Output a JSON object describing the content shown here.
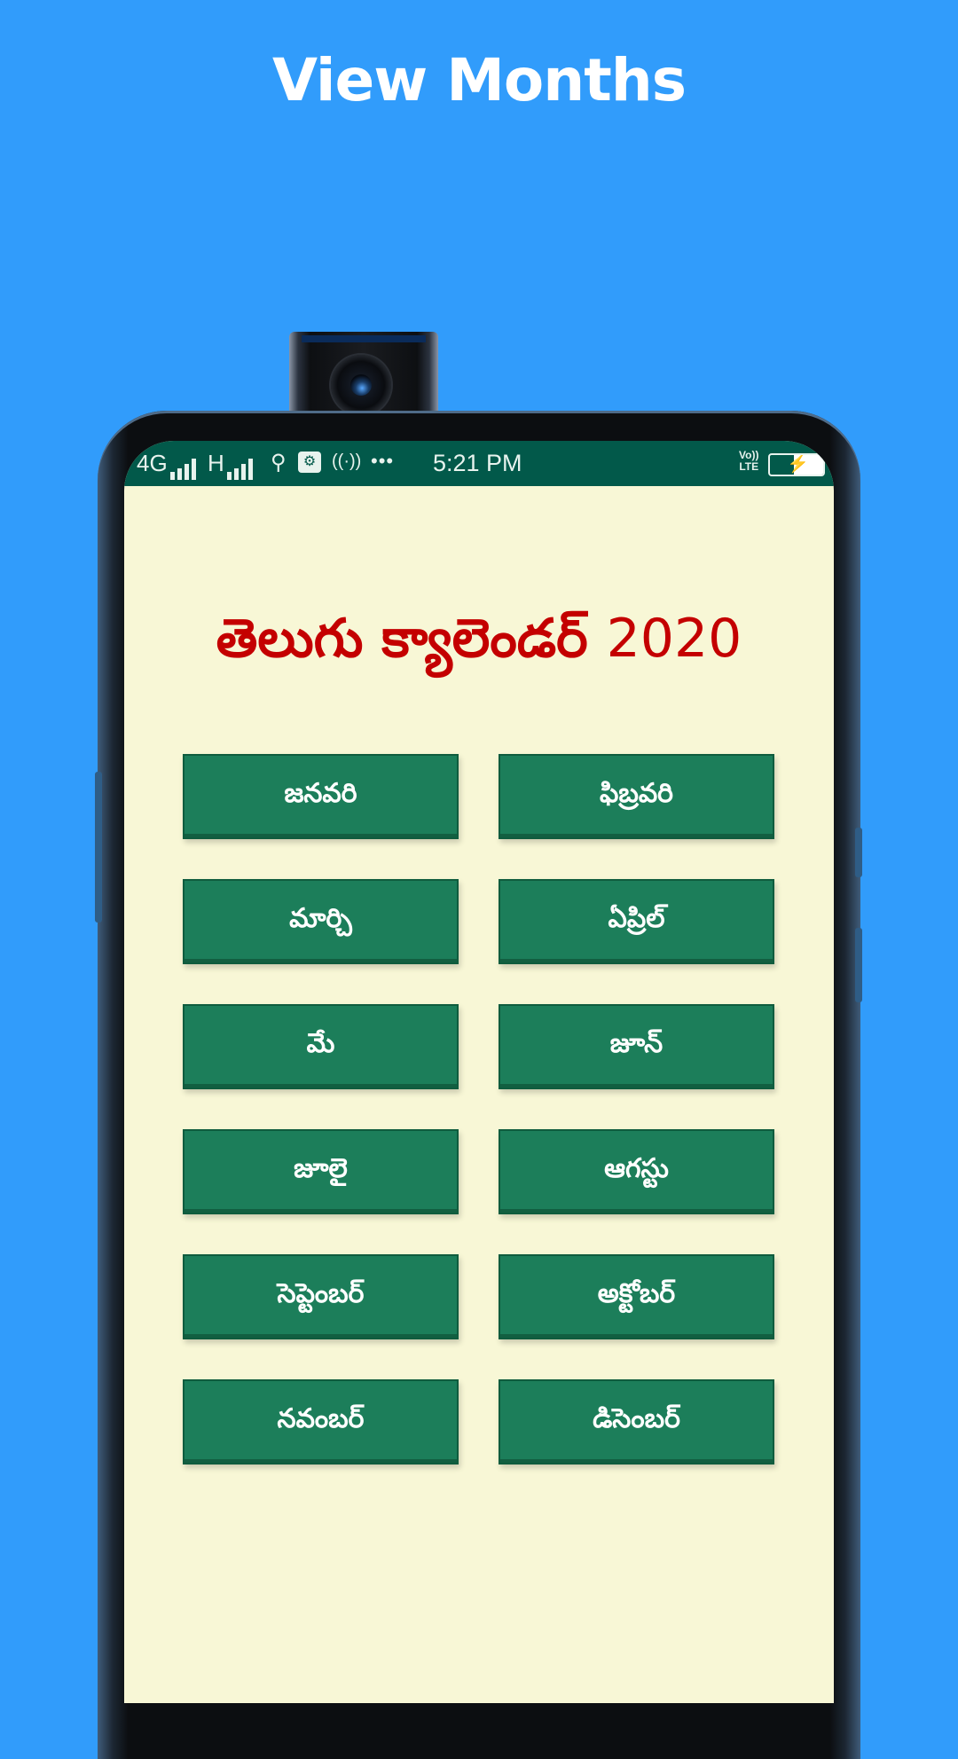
{
  "promo": {
    "headline": "View Months"
  },
  "status_bar": {
    "network_1": "4G",
    "network_2": "H",
    "more_indicator": "•••",
    "time": "5:21 PM",
    "volte_top": "Vo))",
    "volte_bottom": "LTE",
    "icons": [
      "signal-bars-icon",
      "usb-icon",
      "app-notification-icon",
      "hotspot-icon",
      "battery-charging-icon"
    ]
  },
  "app": {
    "title_telugu": "తెలుగు క్యాలెండర్",
    "title_year": "2020",
    "months": [
      {
        "label": "జనవరి"
      },
      {
        "label": "ఫిబ్రవరి"
      },
      {
        "label": "మార్చి"
      },
      {
        "label": "ఏప్రిల్"
      },
      {
        "label": "మే"
      },
      {
        "label": "జూన్"
      },
      {
        "label": "జూలై"
      },
      {
        "label": "ఆగస్టు"
      },
      {
        "label": "సెప్టెంబర్"
      },
      {
        "label": "అక్టోబర్"
      },
      {
        "label": "నవంబర్"
      },
      {
        "label": "డిసెంబర్"
      }
    ]
  },
  "colors": {
    "background": "#319cfb",
    "status_bar": "#02594a",
    "screen_bg": "#f8f7d6",
    "title_red": "#c40000",
    "button_green": "#1c7e5a"
  }
}
